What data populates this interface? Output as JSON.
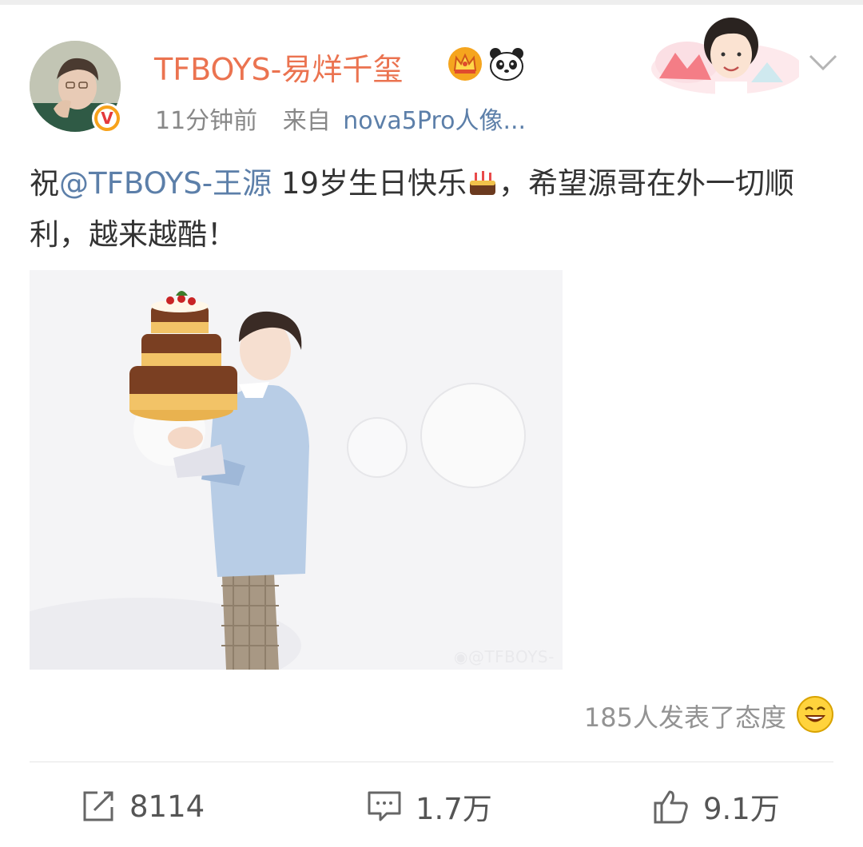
{
  "post": {
    "author": {
      "name": "TFBOYS-易烊千玺",
      "verified_badge": "V",
      "badges": [
        "crown-icon",
        "panda-icon"
      ]
    },
    "meta": {
      "time": "11分钟前",
      "source_prefix": "来自",
      "source": "nova5Pro人像..."
    },
    "text": {
      "prefix": "祝",
      "mention": "@TFBOYS-王源",
      "middle": " 19岁生日快乐",
      "emoji": "cake-emoji-icon",
      "suffix": "，希望源哥在外一切顺利，越来越酷！"
    },
    "image": {
      "watermark": "@TFBOYS-"
    },
    "attitude_text": "185人发表了态度"
  },
  "actions": {
    "repost_count": "8114",
    "comment_count": "1.7万",
    "like_count": "9.1万"
  },
  "colors": {
    "username": "#eb7350",
    "link": "#5c7fa9",
    "meta": "#888888",
    "text": "#333333"
  }
}
